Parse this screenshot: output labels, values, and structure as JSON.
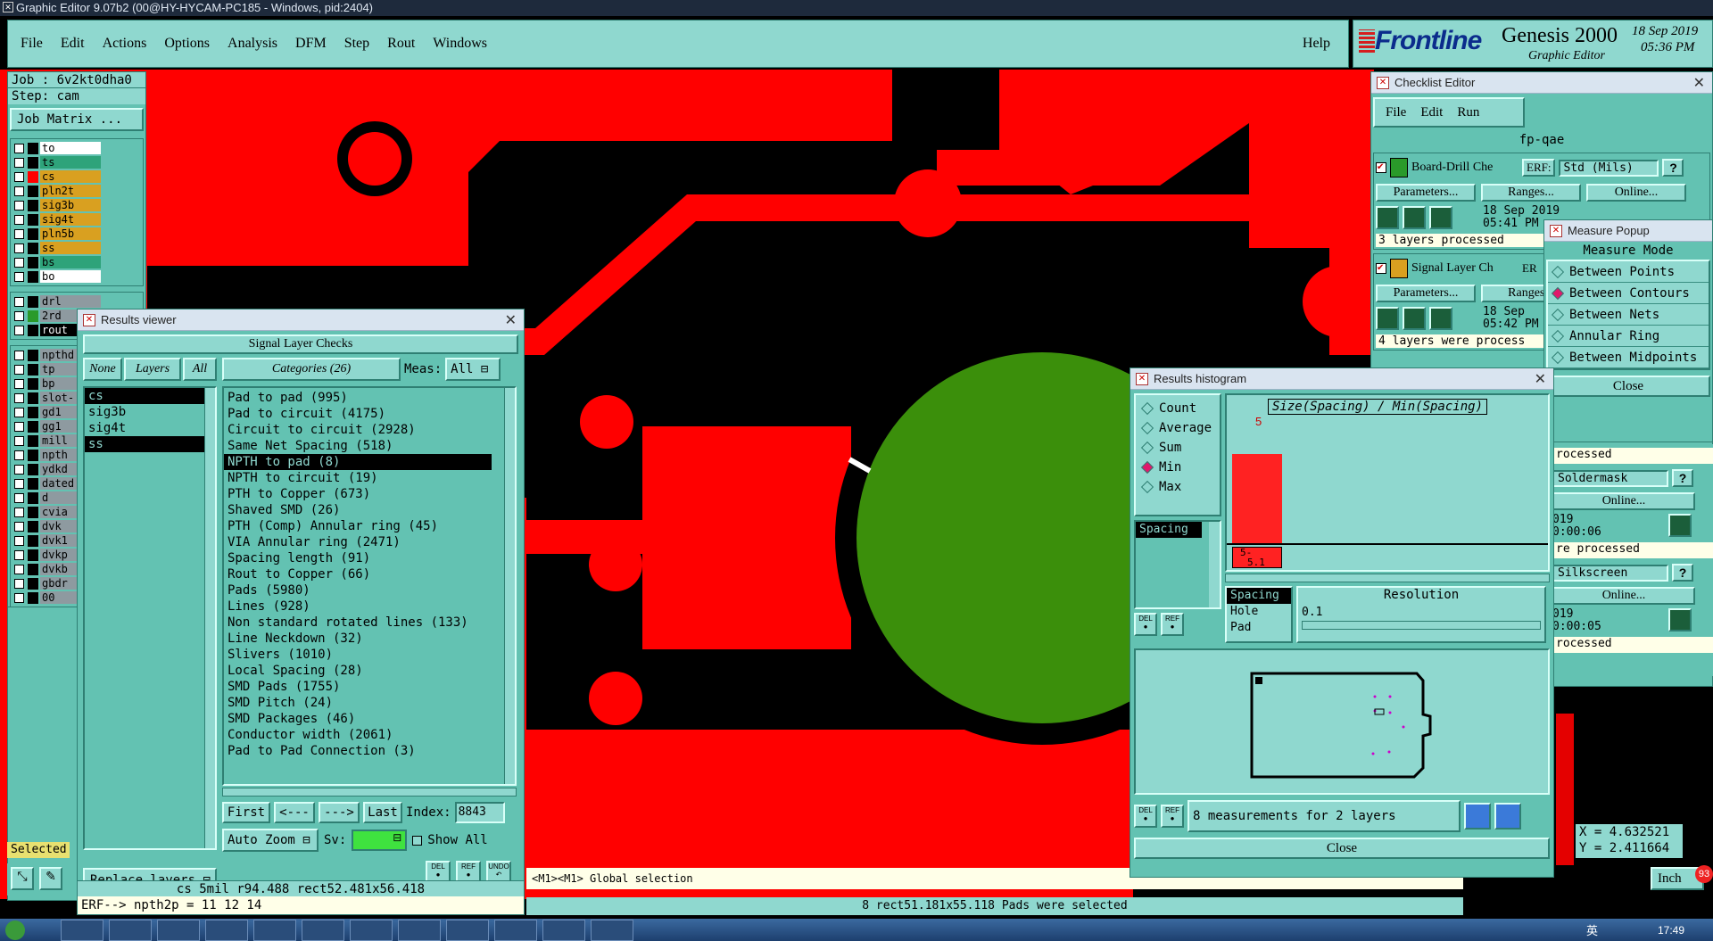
{
  "window": {
    "title": "Graphic Editor 9.07b2 (00@HY-HYCAM-PC185 - Windows, pid:2404)"
  },
  "menubar": {
    "items": [
      "File",
      "Edit",
      "Actions",
      "Options",
      "Analysis",
      "DFM",
      "Step",
      "Rout",
      "Windows"
    ],
    "help": "Help"
  },
  "brand": {
    "logo": "Frontline",
    "product": "Genesis 2000",
    "subtitle": "Graphic Editor",
    "date": "18 Sep 2019",
    "time": "05:36 PM"
  },
  "job": {
    "job": "Job : 6v2kt0dha0",
    "step": "Step: cam",
    "matrix_button": "Job Matrix ..."
  },
  "layers": {
    "group1": [
      {
        "name": "to",
        "color": "#ffffff",
        "swatch": "#000000"
      },
      {
        "name": "ts",
        "color": "#2ea37a",
        "swatch": "#000000"
      },
      {
        "name": "cs",
        "color": "#d9a020",
        "swatch": "#ff0000"
      },
      {
        "name": "pln2t",
        "color": "#d9a020",
        "swatch": "#000000"
      },
      {
        "name": "sig3b",
        "color": "#d9a020",
        "swatch": "#000000"
      },
      {
        "name": "sig4t",
        "color": "#d9a020",
        "swatch": "#000000"
      },
      {
        "name": "pln5b",
        "color": "#d9a020",
        "swatch": "#000000"
      },
      {
        "name": "ss",
        "color": "#d9a020",
        "swatch": "#000000"
      },
      {
        "name": "bs",
        "color": "#2ea37a",
        "swatch": "#000000"
      },
      {
        "name": "bo",
        "color": "#ffffff",
        "swatch": "#000000"
      }
    ],
    "group2": [
      {
        "name": "drl",
        "color": "#8e9aa0",
        "swatch": "#000000"
      },
      {
        "name": "2rd",
        "color": "#8e9aa0",
        "swatch": "#2a9a2a"
      },
      {
        "name": "rout",
        "color": "#000000",
        "swatch": "#000000"
      }
    ],
    "group3": [
      "npthd",
      "tp",
      "bp",
      "slot-",
      "gd1",
      "gg1",
      "mill",
      "npth",
      "ydkd",
      "dated",
      "d",
      "cvia",
      "dvk",
      "dvk1",
      "dvkp",
      "dvkb",
      "gbdr",
      "00"
    ],
    "selected_label": "Selected"
  },
  "results_viewer": {
    "title": "Results viewer",
    "header": "Signal Layer Checks",
    "btn_none": "None",
    "btn_layers": "Layers",
    "btn_all": "All",
    "categories_label": "Categories (26)",
    "meas_label": "Meas:",
    "meas_value": "All",
    "layer_list": [
      "cs",
      "sig3b",
      "sig4t",
      "ss"
    ],
    "categories": [
      "Pad to pad (995)",
      "Pad to circuit (4175)",
      "Circuit to circuit (2928)",
      "Same Net Spacing (518)",
      "NPTH to pad (8)",
      "NPTH to circuit (19)",
      "PTH to Copper (673)",
      "Shaved SMD (26)",
      "PTH (Comp) Annular ring (45)",
      "VIA Annular ring (2471)",
      "Spacing length (91)",
      "Rout to Copper (66)",
      "Pads (5980)",
      "Lines (928)",
      "Non standard rotated lines (133)",
      "Line Neckdown (32)",
      "Slivers (1010)",
      "Local Spacing (28)",
      "SMD Pads (1755)",
      "SMD Pitch (24)",
      "SMD Packages (46)",
      "Conductor width (2061)",
      "Pad to Pad Connection (3)"
    ],
    "nav": {
      "first": "First",
      "prev": "<---",
      "next": "--->",
      "last": "Last",
      "index_label": "Index:",
      "index_value": "8843"
    },
    "auto_zoom": "Auto Zoom",
    "sv_label": "Sv:",
    "show_all": "Show All",
    "replace_layers": "Replace layers",
    "btn_del": "DEL",
    "btn_ref": "REF",
    "btn_undo": "UNDO"
  },
  "status": {
    "feature": "cs  5mil   r94.488   rect52.481x56.418",
    "erf": "ERF--> npth2p = 11 12 14",
    "selection": "8 rect51.181x55.118 Pads were selected",
    "mouse_hint": "<M1><M1> Global selection",
    "x": "X = 4.632521",
    "y": "Y = 2.411664",
    "units": "Inch"
  },
  "checklist": {
    "title": "Checklist Editor",
    "menu": [
      "File",
      "Edit",
      "Run"
    ],
    "name": "fp-qae",
    "erf_label": "ERF:",
    "erf_value": "Std (Mils)",
    "help_q": "?",
    "parameters": "Parameters...",
    "ranges": "Ranges...",
    "online": "Online...",
    "items": [
      {
        "name": "Board-Drill Che",
        "date": "18 Sep 2019",
        "time": "05:41 PM",
        "status": "3 layers processed"
      },
      {
        "name": "Signal Layer Ch",
        "erf": "ER",
        "date": "18 Sep",
        "time": "05:42 PM",
        "status": "4 layers were process"
      }
    ],
    "partial": [
      {
        "status": "rocessed",
        "field": "Soldermask",
        "date": "019",
        "time": "0:00:06",
        "status2": "re processed"
      },
      {
        "field": "Silkscreen",
        "date": "019",
        "time": "0:00:05",
        "status2": "rocessed"
      }
    ]
  },
  "measure": {
    "title": "Measure Popup",
    "header": "Measure Mode",
    "options": [
      "Between Points",
      "Between Contours",
      "Between Nets",
      "Annular Ring",
      "Between Midpoints"
    ],
    "selected": "Between Contours",
    "close": "Close"
  },
  "histogram": {
    "title": "Results histogram",
    "modes": [
      "Count",
      "Average",
      "Sum",
      "Min",
      "Max"
    ],
    "selected_mode": "Min",
    "metric_title": "Size(Spacing) / Min(Spacing)",
    "list": [
      "Spacing"
    ],
    "bar_value": 5,
    "bar_label_top": "5",
    "bin_label_a": "5-",
    "bin_label_b": "5.1",
    "fields": [
      "Spacing",
      "Hole",
      "Pad"
    ],
    "resolution_label": "Resolution",
    "resolution_value": "0.1",
    "summary": "8 measurements for 2 layers",
    "close": "Close",
    "btn_del": "DEL",
    "btn_ref": "REF"
  },
  "taskbar": {
    "time": "17:49",
    "badge": "93",
    "ime": "英"
  },
  "colors": {
    "copper": "#ff0000",
    "pad": "#3b8f0b",
    "background": "#000000",
    "ui": "#63c2b2"
  }
}
